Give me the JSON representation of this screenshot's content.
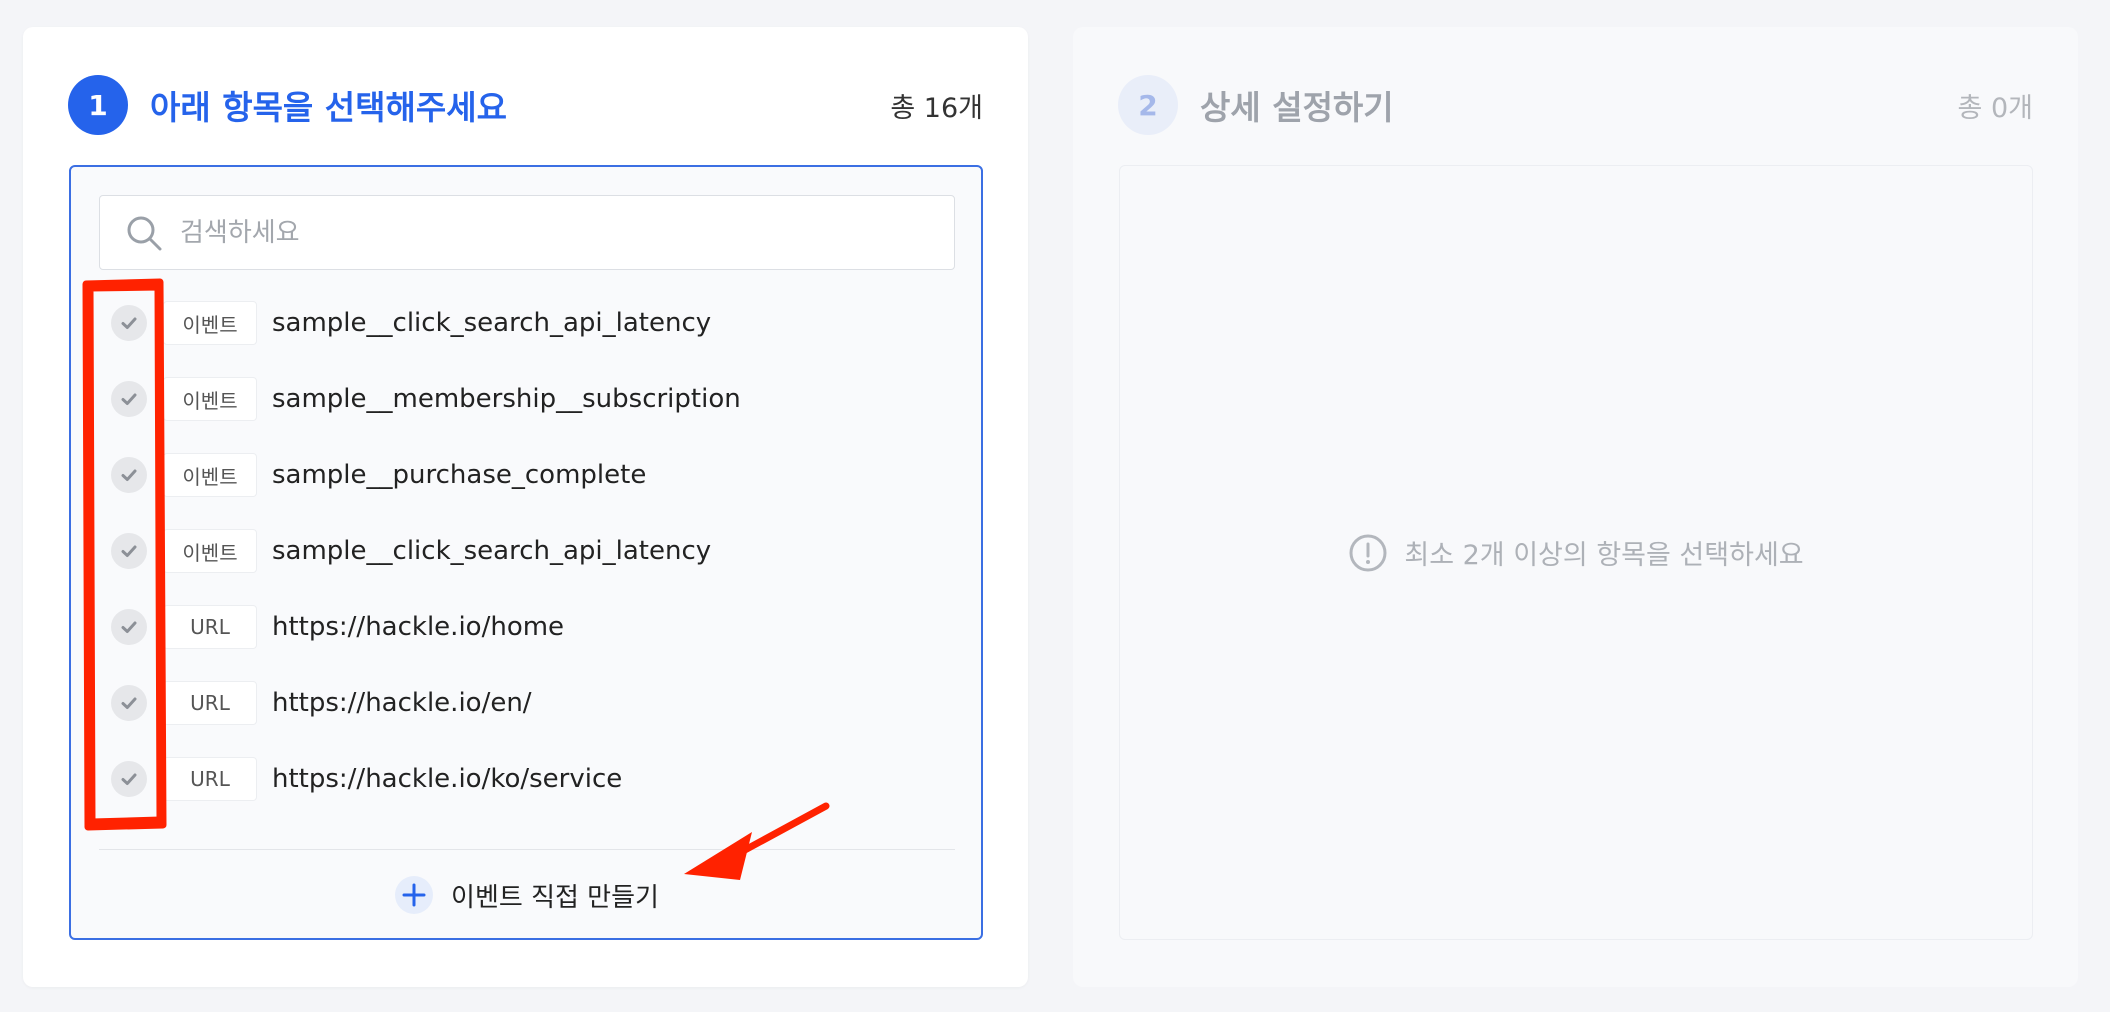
{
  "step1": {
    "number": "1",
    "title": "아래 항목을 선택해주세요",
    "count": "총 16개",
    "search_placeholder": "검색하세요",
    "items": [
      {
        "tag": "이벤트",
        "name": "sample__click_search_api_latency"
      },
      {
        "tag": "이벤트",
        "name": "sample__membership__subscription"
      },
      {
        "tag": "이벤트",
        "name": "sample__purchase_complete"
      },
      {
        "tag": "이벤트",
        "name": "sample__click_search_api_latency"
      },
      {
        "tag": "URL",
        "name": "https://hackle.io/home"
      },
      {
        "tag": "URL",
        "name": "https://hackle.io/en/"
      },
      {
        "tag": "URL",
        "name": "https://hackle.io/ko/service"
      }
    ],
    "create_label": "이벤트 직접 만들기"
  },
  "step2": {
    "number": "2",
    "title": "상세 설정하기",
    "count": "총 0개",
    "notice": "최소 2개 이상의 항목을 선택하세요"
  },
  "icons": {
    "search": "search-icon",
    "check": "check-icon",
    "plus": "plus-icon",
    "info": "exclamation-circle-icon"
  },
  "colors": {
    "primary": "#2563eb",
    "annotation": "#ff2200"
  }
}
